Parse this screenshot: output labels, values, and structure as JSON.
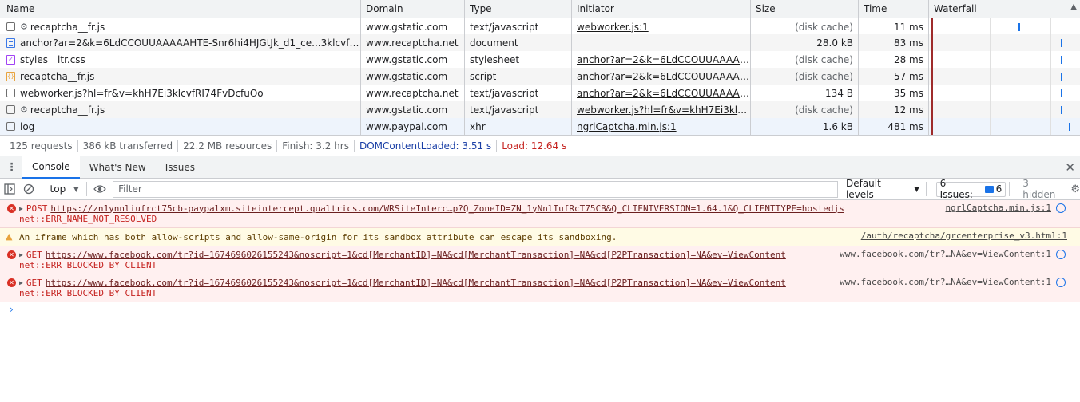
{
  "network": {
    "columns": [
      "Name",
      "Domain",
      "Type",
      "Initiator",
      "Size",
      "Time",
      "Waterfall"
    ],
    "rows": [
      {
        "icon": "checkbox-icon",
        "gear": true,
        "name": "recaptcha__fr.js",
        "domain": "www.gstatic.com",
        "type": "text/javascript",
        "initiator": "webworker.js:1",
        "size": "(disk cache)",
        "time": "11 ms"
      },
      {
        "icon": "document-icon",
        "gear": false,
        "name": "anchor?ar=2&k=6LdCCOUUAAAAAHTE-Snr6hi4HJGtJk_d1_ce...3klcvfRI74FvDc...",
        "domain": "www.recaptcha.net",
        "type": "document",
        "initiator": "",
        "size": "28.0 kB",
        "time": "83 ms"
      },
      {
        "icon": "stylesheet-icon",
        "gear": false,
        "name": "styles__ltr.css",
        "domain": "www.gstatic.com",
        "type": "stylesheet",
        "initiator": "anchor?ar=2&k=6LdCCOUUAAAAAHT...",
        "size": "(disk cache)",
        "time": "28 ms"
      },
      {
        "icon": "script-icon",
        "gear": false,
        "name": "recaptcha__fr.js",
        "domain": "www.gstatic.com",
        "type": "script",
        "initiator": "anchor?ar=2&k=6LdCCOUUAAAAAHT...",
        "size": "(disk cache)",
        "time": "57 ms"
      },
      {
        "icon": "checkbox-icon",
        "gear": false,
        "name": "webworker.js?hl=fr&v=khH7Ei3klcvfRI74FvDcfuOo",
        "domain": "www.recaptcha.net",
        "type": "text/javascript",
        "initiator": "anchor?ar=2&k=6LdCCOUUAAAAAHT...",
        "size": "134 B",
        "time": "35 ms"
      },
      {
        "icon": "checkbox-icon",
        "gear": true,
        "name": "recaptcha__fr.js",
        "domain": "www.gstatic.com",
        "type": "text/javascript",
        "initiator": "webworker.js?hl=fr&v=khH7Ei3klcvfRI7...",
        "size": "(disk cache)",
        "time": "12 ms"
      },
      {
        "icon": "checkbox-icon",
        "gear": false,
        "name": "log",
        "domain": "www.paypal.com",
        "type": "xhr",
        "initiator": "ngrlCaptcha.min.js:1",
        "size": "1.6 kB",
        "time": "481 ms"
      }
    ]
  },
  "status": {
    "requests": "125 requests",
    "transferred": "386 kB transferred",
    "resources": "22.2 MB resources",
    "finish": "Finish: 3.2 hrs",
    "dom": "DOMContentLoaded: 3.51 s",
    "load": "Load: 12.64 s"
  },
  "drawer": {
    "tabs": [
      "Console",
      "What's New",
      "Issues"
    ]
  },
  "console_toolbar": {
    "context": "top",
    "filter_placeholder": "Filter",
    "levels": "Default levels",
    "issues": "6 Issues:",
    "issues_count": "6",
    "hidden": "3 hidden"
  },
  "messages": [
    {
      "kind": "error",
      "method": "POST",
      "url": "https://zn1ynnliufrct75cb-paypalxm.siteintercept.qualtrics.com/WRSiteInterc…p?Q_ZoneID=ZN_1yNnlIufRcT75CB&Q_CLIENTVERSION=1.64.1&Q_CLIENTTYPE=hostedjs",
      "error": "net::ERR_NAME_NOT_RESOLVED",
      "source": "ngrlCaptcha.min.js:1"
    },
    {
      "kind": "warning",
      "text": "An iframe which has both allow-scripts and allow-same-origin for its sandbox attribute can escape its sandboxing.",
      "source": "/auth/recaptcha/grcenterprise_v3.html:1"
    },
    {
      "kind": "error",
      "method": "GET",
      "url": "https://www.facebook.com/tr?id=1674696026155243&noscript=1&cd[MerchantID]=NA&cd[MerchantTransaction]=NA&cd[P2PTransaction]=NA&ev=ViewContent",
      "error": "net::ERR_BLOCKED_BY_CLIENT",
      "source": "www.facebook.com/tr?…NA&ev=ViewContent:1"
    },
    {
      "kind": "error",
      "method": "GET",
      "url": "https://www.facebook.com/tr?id=1674696026155243&noscript=1&cd[MerchantID]=NA&cd[MerchantTransaction]=NA&cd[P2PTransaction]=NA&ev=ViewContent",
      "error": "net::ERR_BLOCKED_BY_CLIENT",
      "source": "www.facebook.com/tr?…NA&ev=ViewContent:1"
    }
  ],
  "colors": {
    "error_bg": "#fff0f0",
    "warning_bg": "#fffbe5",
    "accent": "#1a73e8"
  }
}
